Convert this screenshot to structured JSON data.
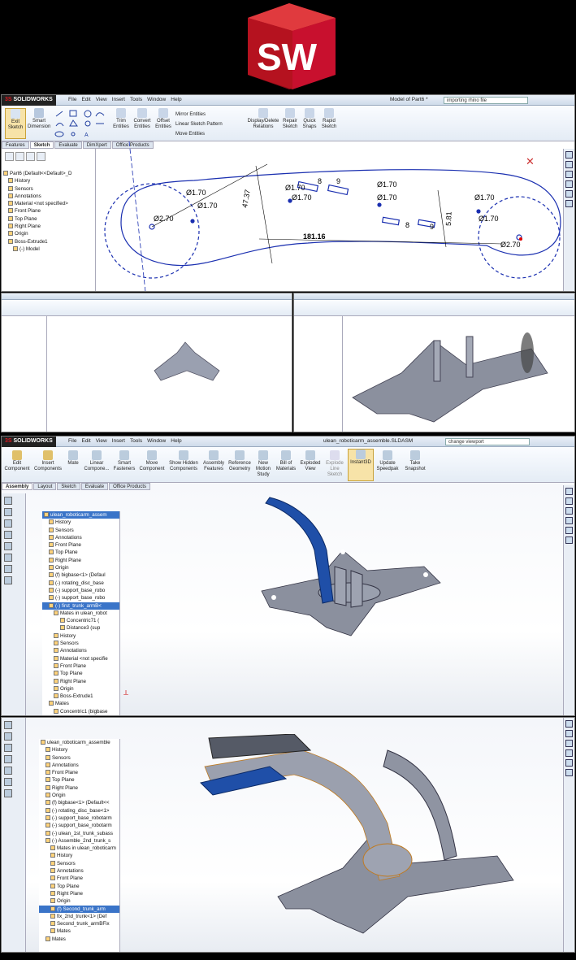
{
  "logo": {
    "text": "SW",
    "colors": {
      "cube": "#c8102e",
      "letters": "#ffffff"
    }
  },
  "brand": "SOLIDWORKS",
  "menu": [
    "File",
    "Edit",
    "View",
    "Insert",
    "Tools",
    "Window",
    "Help"
  ],
  "p1": {
    "title": "Model of Part6 *",
    "search": "importing rhino file",
    "cmd": [
      "Exit Sketch",
      "Smart Dimension",
      "Trim Entities",
      "Convert Entities",
      "Offset Entities",
      "Mirror Entities",
      "Linear Sketch Pattern",
      "Move Entities",
      "Display/Delete Relations",
      "Repair Sketch",
      "Quick Snaps",
      "Rapid Sketch"
    ],
    "tabs": [
      "Features",
      "Sketch",
      "Evaluate",
      "DimXpert",
      "Office Products"
    ],
    "tree": [
      "Part6 (Default<<Default>_D",
      "History",
      "Sensors",
      "Annotations",
      "Material <not specified>",
      "Front Plane",
      "Top Plane",
      "Right Plane",
      "Origin",
      "Boss-Extrude1",
      "(-) Model"
    ],
    "dims": [
      "Ø2.70",
      "Ø1.70",
      "Ø1.70",
      "47.37",
      "Ø1.70",
      "Ø1.70",
      "8",
      "9",
      "Ø1.70",
      "Ø1.70",
      "5.81",
      "Ø1.70",
      "Ø1.70",
      "8",
      "9",
      "181.16",
      "Ø2.70"
    ]
  },
  "p2": {
    "title": "ulean_roboticarm_assemble.SLDASM",
    "search": "change viewport",
    "cmd": [
      "Edit Component",
      "Insert Components",
      "Mate",
      "Linear Compone...",
      "Smart Fasteners",
      "Move Component",
      "Show Hidden Components",
      "Assembly Features",
      "Reference Geometry",
      "New Motion Study",
      "Bill of Materials",
      "Exploded View",
      "Explode Line Sketch",
      "Instant3D",
      "Update Speedpak",
      "Take Snapshot"
    ],
    "tabs": [
      "Assembly",
      "Layout",
      "Sketch",
      "Evaluate",
      "Office Products"
    ],
    "tree": [
      "ulean_roboticarm_assem",
      "History",
      "Sensors",
      "Annotations",
      "Front Plane",
      "Top Plane",
      "Right Plane",
      "Origin",
      "(f) bigbase<1> (Defaul",
      "(-) rotating_disc_base",
      "(-) support_base_robo",
      "(-) support_base_robo",
      "(-) first_trunk_armB<",
      "Mates in ulean_robot",
      "Concentric71 (",
      "Distance3 (sup",
      "History",
      "Sensors",
      "Annotations",
      "Material <not specifie",
      "Front Plane",
      "Top Plane",
      "Right Plane",
      "Origin",
      "Boss-Extrude1",
      "Mates",
      "Concentric1 (bigbase"
    ]
  },
  "p3": {
    "tree": [
      "ulean_roboticarm_assemble",
      "History",
      "Sensors",
      "Annotations",
      "Front Plane",
      "Top Plane",
      "Right Plane",
      "Origin",
      "(f) bigbase<1> (Default<<",
      "(-) rotating_disc_base<1>",
      "(-) support_base_robotarm",
      "(-) support_base_robotarm",
      "(-) ulean_1st_trunk_subass",
      "(-) Assemble_2nd_trunk_s",
      "Mates in ulean_roboticarm",
      "History",
      "Sensors",
      "Annotations",
      "Front Plane",
      "Top Plane",
      "Right Plane",
      "Origin",
      "(f) Second_trunk_arm",
      "fix_2nd_trunk<1> (Def",
      "Second_trunk_armBFix",
      "Mates",
      "Mates"
    ]
  },
  "colors": {
    "sketch": "#1a2fb0",
    "part": "#9aa0b0",
    "arm": "#1f4fa8",
    "select": "#3a74c8"
  }
}
